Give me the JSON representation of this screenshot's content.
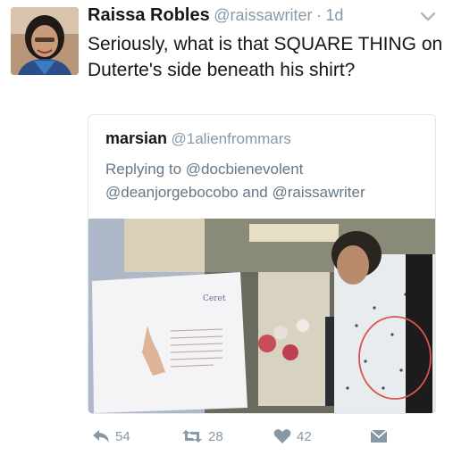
{
  "tweet": {
    "display_name": "Raissa Robles",
    "handle": "@raissawriter",
    "separator": "·",
    "time": "1d",
    "text": "Seriously, what is that SQUARE THING on Duterte's side beneath his shirt?",
    "avatar_icon": "user-avatar-photo",
    "menu_icon": "chevron-down-icon"
  },
  "quoted": {
    "display_name": "marsian",
    "handle": "@1alienfrommars",
    "replying_prefix": "Replying to ",
    "replying_to": [
      "@docbienevolent",
      "@deanjorgebocobo"
    ],
    "replying_joiner": " and ",
    "replying_last": "@raissawriter",
    "image_icon": "photo-image",
    "image_card_logo": "Ceret"
  },
  "actions": {
    "reply_count": "54",
    "retweet_count": "28",
    "like_count": "42",
    "reply_icon": "reply-icon",
    "retweet_icon": "retweet-icon",
    "like_icon": "heart-icon",
    "dm_icon": "direct-message-icon"
  },
  "colors": {
    "text_primary": "#14171a",
    "text_secondary": "#8899a6",
    "border": "#e1e8ed",
    "annotation_circle": "#d9534f"
  }
}
